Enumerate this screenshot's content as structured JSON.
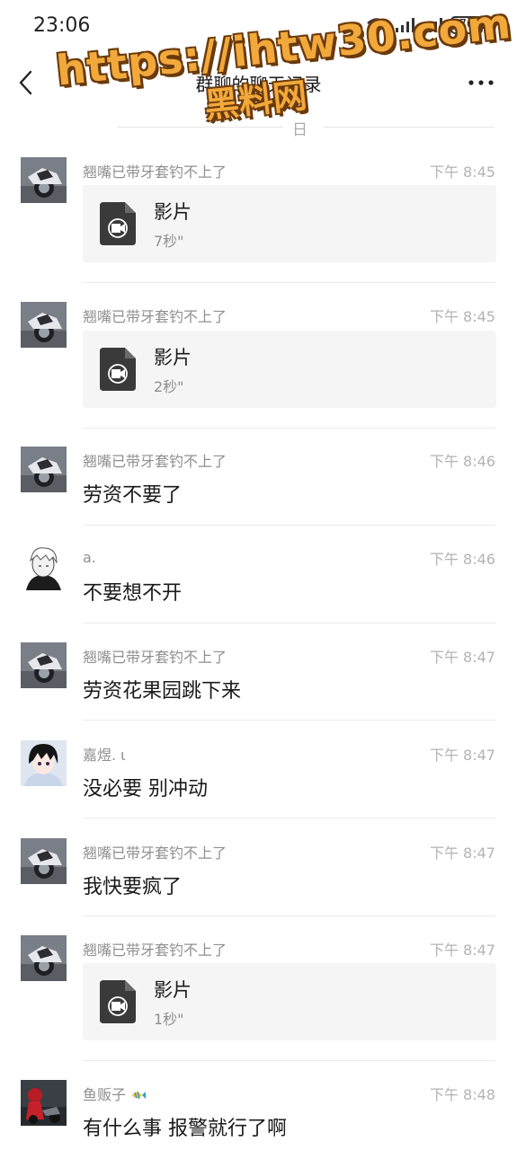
{
  "status_bar": {
    "time": "23:06",
    "battery": "70",
    "icons": [
      "wifi-icon",
      "signal-icon",
      "signal-icon",
      "battery-icon"
    ]
  },
  "nav": {
    "title": "群聊的聊天记录",
    "back_icon": "chevron-left-icon",
    "more_icon": "more-icon"
  },
  "date_label": "日",
  "watermark": {
    "url": "https://ihtw30.com",
    "subtitle": "黑料网"
  },
  "file_labels": {
    "name": "影片",
    "icon": "video-file-icon"
  },
  "messages": [
    {
      "sender": "翘嘴已带牙套钓不上了",
      "time": "下午 8:45",
      "type": "file",
      "duration": "7秒\"",
      "avatar": "motorcycle"
    },
    {
      "sender": "翘嘴已带牙套钓不上了",
      "time": "下午 8:45",
      "type": "file",
      "duration": "2秒\"",
      "avatar": "motorcycle"
    },
    {
      "sender": "翘嘴已带牙套钓不上了",
      "time": "下午 8:46",
      "type": "text",
      "text": "劳资不要了",
      "avatar": "motorcycle"
    },
    {
      "sender": "a.",
      "time": "下午 8:46",
      "type": "text",
      "text": "不要想不开",
      "avatar": "anime-white"
    },
    {
      "sender": "翘嘴已带牙套钓不上了",
      "time": "下午 8:47",
      "type": "text",
      "text": "劳资花果园跳下来",
      "avatar": "motorcycle"
    },
    {
      "sender": "嘉煜. ι",
      "time": "下午 8:47",
      "type": "text",
      "text": "没必要 别冲动",
      "avatar": "anime-dark"
    },
    {
      "sender": "翘嘴已带牙套钓不上了",
      "time": "下午 8:47",
      "type": "text",
      "text": "我快要疯了",
      "avatar": "motorcycle"
    },
    {
      "sender": "翘嘴已带牙套钓不上了",
      "time": "下午 8:47",
      "type": "file",
      "duration": "1秒\"",
      "avatar": "motorcycle"
    },
    {
      "sender": "鱼贩子",
      "time": "下午 8:48",
      "type": "text",
      "text": "有什么事 报警就行了啊",
      "avatar": "red-rider"
    }
  ],
  "colors": {
    "background": "#ffffff",
    "text_primary": "#1a1a1a",
    "text_secondary": "#8f8f8f",
    "time": "#b3b3b3",
    "card": "#f5f5f5",
    "watermark": "#f2a93b"
  }
}
